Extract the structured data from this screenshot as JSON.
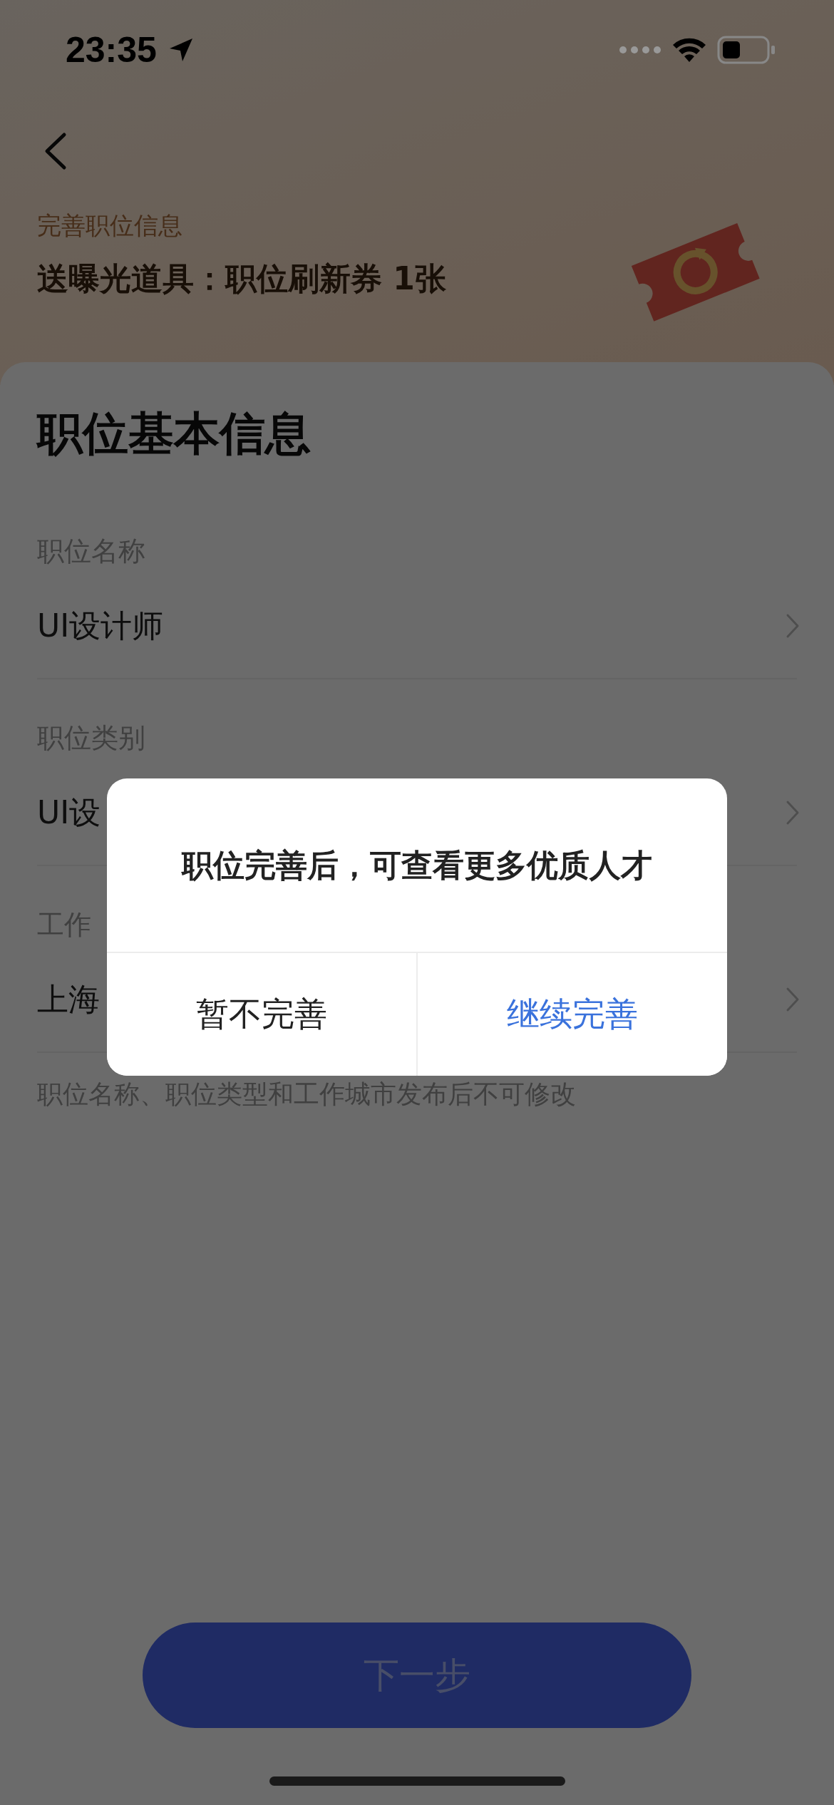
{
  "status_bar": {
    "time": "23:35"
  },
  "header": {
    "subtitle": "完善职位信息",
    "reward": "送曝光道具：职位刷新券 1张"
  },
  "form": {
    "title": "职位基本信息",
    "fields": [
      {
        "label": "职位名称",
        "value": "UI设计师"
      },
      {
        "label": "职位类别",
        "value": "UI设"
      },
      {
        "label": "工作",
        "value": "上海"
      }
    ],
    "note": "职位名称、职位类型和工作城市发布后不可修改"
  },
  "next_button": {
    "label": "下一步",
    "disabled": true
  },
  "dialog": {
    "message": "职位完善后，可查看更多优质人才",
    "buttons": [
      {
        "label": "暂不完善",
        "kind": "secondary"
      },
      {
        "label": "继续完善",
        "kind": "primary"
      }
    ]
  }
}
